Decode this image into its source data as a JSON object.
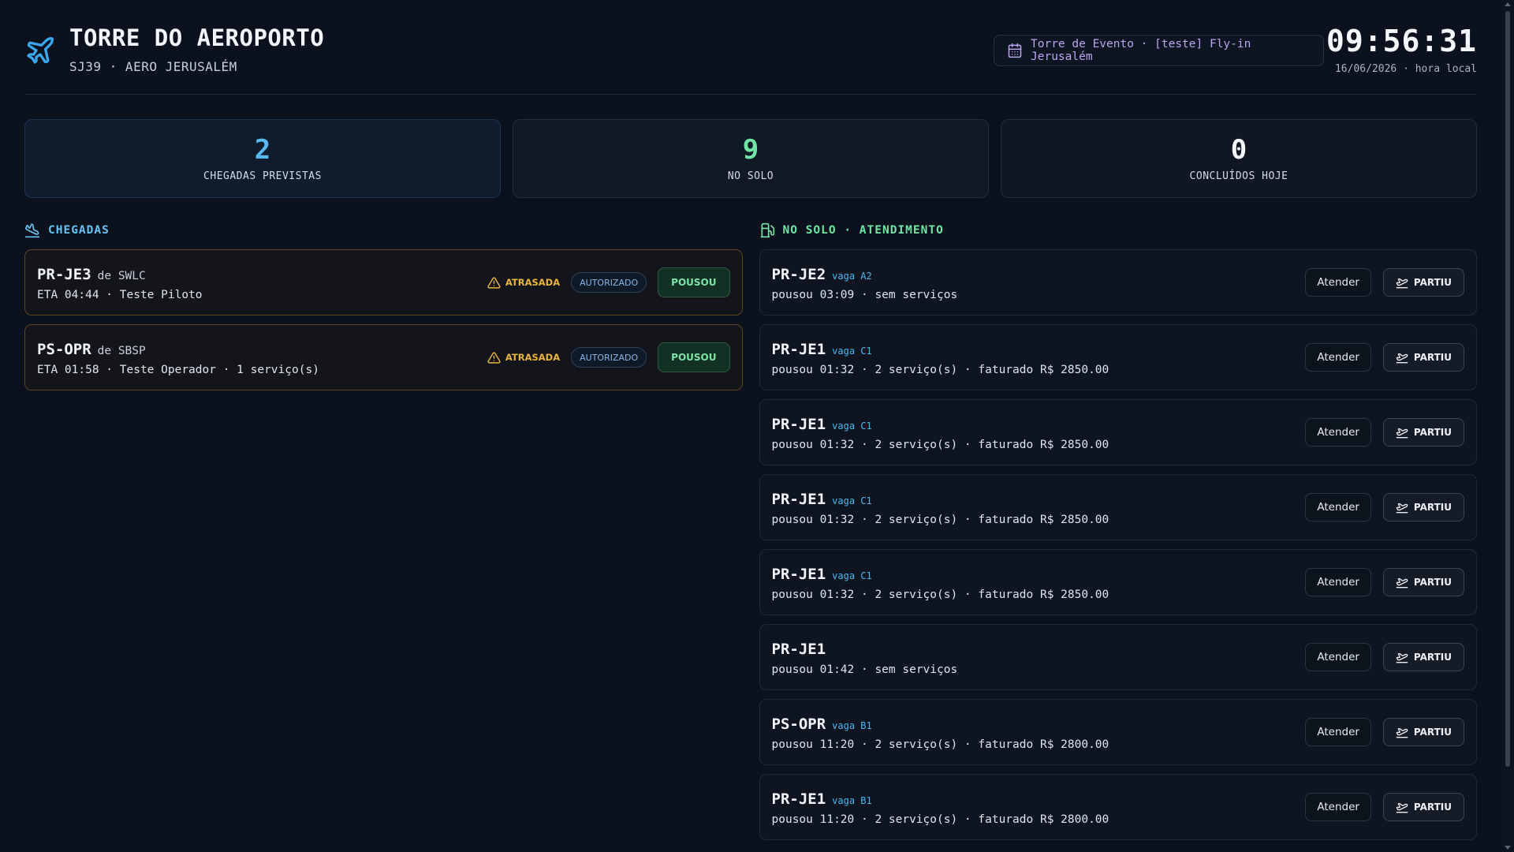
{
  "header": {
    "title": "TORRE DO AEROPORTO",
    "subtitle": "SJ39 · AERO JERUSALÉM",
    "event_label": "Torre de Evento · [teste] Fly-in Jerusalém",
    "clock": "09:56:31",
    "date_label": "16/06/2026 · hora local"
  },
  "stats": [
    {
      "value": "2",
      "label": "CHEGADAS PREVISTAS",
      "color": "#5ab8f0"
    },
    {
      "value": "9",
      "label": "NO SOLO",
      "color": "#6fe6a5"
    },
    {
      "value": "0",
      "label": "CONCLUÍDOS HOJE",
      "color": "#f2f5fa"
    }
  ],
  "arrivals": {
    "title": "CHEGADAS",
    "items": [
      {
        "reg": "PR-JE3",
        "from": "de SWLC",
        "meta": "ETA 04:44 · Teste Piloto",
        "late": "ATRASADA",
        "auth": "AUTORIZADO",
        "action": "POUSOU"
      },
      {
        "reg": "PS-OPR",
        "from": "de SBSP",
        "meta": "ETA 01:58 · Teste Operador · 1 serviço(s)",
        "late": "ATRASADA",
        "auth": "AUTORIZADO",
        "action": "POUSOU"
      }
    ]
  },
  "ground": {
    "title": "NO SOLO · ATENDIMENTO",
    "attend_label": "Atender",
    "depart_label": "PARTIU",
    "items": [
      {
        "reg": "PR-JE2",
        "spot": "vaga A2",
        "meta": "pousou 03:09 · sem serviços"
      },
      {
        "reg": "PR-JE1",
        "spot": "vaga C1",
        "meta": "pousou 01:32 · 2 serviço(s) · faturado R$ 2850.00"
      },
      {
        "reg": "PR-JE1",
        "spot": "vaga C1",
        "meta": "pousou 01:32 · 2 serviço(s) · faturado R$ 2850.00"
      },
      {
        "reg": "PR-JE1",
        "spot": "vaga C1",
        "meta": "pousou 01:32 · 2 serviço(s) · faturado R$ 2850.00"
      },
      {
        "reg": "PR-JE1",
        "spot": "vaga C1",
        "meta": "pousou 01:32 · 2 serviço(s) · faturado R$ 2850.00"
      },
      {
        "reg": "PR-JE1",
        "spot": "",
        "meta": "pousou 01:42 · sem serviços"
      },
      {
        "reg": "PS-OPR",
        "spot": "vaga B1",
        "meta": "pousou 11:20 · 2 serviço(s) · faturado R$ 2800.00"
      },
      {
        "reg": "PR-JE1",
        "spot": "vaga B1",
        "meta": "pousou 11:20 · 2 serviço(s) · faturado R$ 2800.00"
      }
    ]
  },
  "icons": {
    "brand": "plane-icon",
    "event": "calendar-icon",
    "arrivals": "plane-landing-icon",
    "ground": "fuel-pump-icon",
    "late": "warning-icon",
    "depart": "plane-takeoff-icon"
  }
}
